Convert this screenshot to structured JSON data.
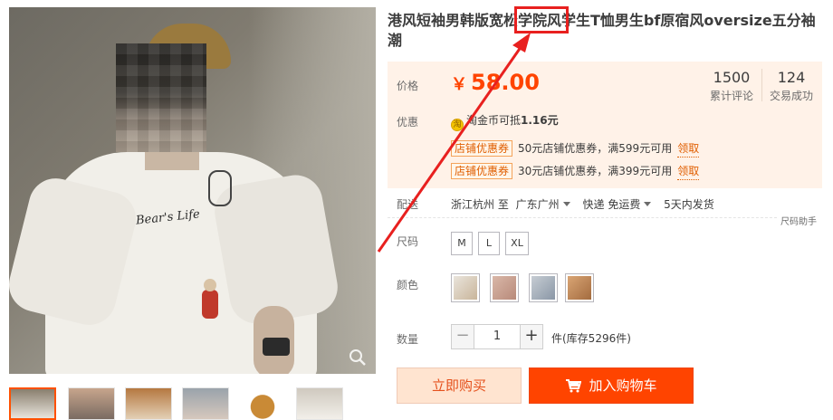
{
  "product": {
    "title": "港风短袖男韩版宽松学院风学生T恤男生bf原宿风oversize五分袖潮"
  },
  "price_panel": {
    "price_label": "价格",
    "currency": "￥",
    "price": "58.00",
    "stats": [
      {
        "value": "1500",
        "label": "累计评论"
      },
      {
        "value": "124",
        "label": "交易成功"
      }
    ],
    "promo_label": "优惠",
    "coin_icon": "淘",
    "coin_text": "淘金币可抵",
    "coin_amount": "1.16元",
    "coupons": [
      {
        "tag": "店铺优惠券",
        "desc": "50元店铺优惠券，满599元可用",
        "action": "领取"
      },
      {
        "tag": "店铺优惠券",
        "desc": "30元店铺优惠券，满399元可用",
        "action": "领取"
      }
    ]
  },
  "delivery": {
    "label": "配送",
    "from": "浙江杭州 至",
    "to": "广东广州",
    "shipping": "快递 免运费",
    "dispatch": "5天内发货"
  },
  "size_help": "尺码助手",
  "options": {
    "size_label": "尺码",
    "sizes": [
      "M",
      "L",
      "XL"
    ],
    "color_label": "颜色",
    "colors": [
      "#c9b59a",
      "#b88a7a",
      "#8a97a6",
      "#a36b3f"
    ]
  },
  "quantity": {
    "label": "数量",
    "minus": "−",
    "value": "1",
    "plus": "+",
    "stock": "件(库存5296件)"
  },
  "buttons": {
    "buy_now": "立即购买",
    "add_to_cart": "加入购物车"
  },
  "image": {
    "print_text": "Bear's Life"
  },
  "colors": {
    "accent": "#ff4400",
    "price": "#ff4400",
    "panel_bg": "#fff2e8",
    "annotation": "#e8201f"
  }
}
